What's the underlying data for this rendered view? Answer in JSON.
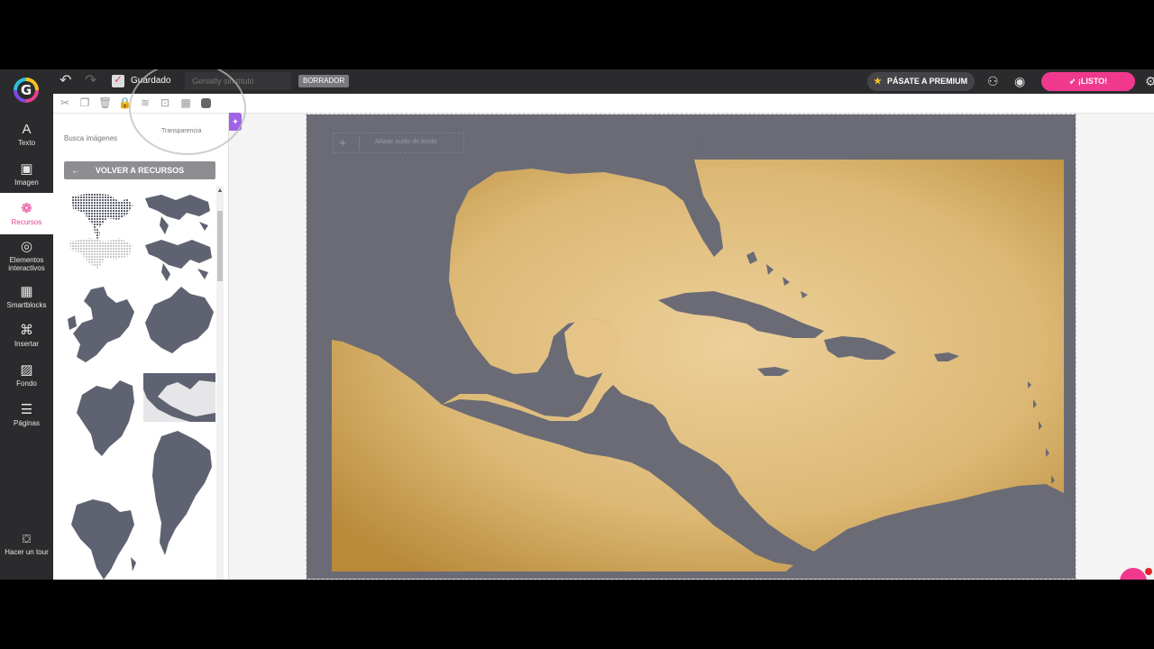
{
  "app": {
    "logo_letter": "G",
    "saved_label": "Guardado",
    "title_placeholder": "Genially sin título",
    "draft_badge": "BORRADOR",
    "premium_label": "PÁSATE A PREMIUM",
    "ready_label": "¡LISTO!"
  },
  "toolbar": {
    "tooltip": "Transparencia",
    "icons": [
      "cut-icon",
      "duplicate-icon",
      "delete-icon",
      "lock-icon",
      "layers-icon",
      "crop-icon",
      "transparency-icon",
      "color-icon"
    ]
  },
  "sidebar": {
    "items": [
      {
        "label": "Texto",
        "icon": "A"
      },
      {
        "label": "Imagen",
        "icon": "▣"
      },
      {
        "label": "Recursos",
        "icon": "❁"
      },
      {
        "label": "Elementos interactivos",
        "icon": "◎"
      },
      {
        "label": "Smartblocks",
        "icon": "▦"
      },
      {
        "label": "Insertar",
        "icon": "⌘"
      },
      {
        "label": "Fondo",
        "icon": "▨"
      },
      {
        "label": "Páginas",
        "icon": "☰"
      }
    ],
    "active_index": 2,
    "tour_label": "Hacer un tour"
  },
  "panel": {
    "search_placeholder": "Busca imágenes",
    "back_label": "VOLVER A RECURSOS",
    "thumbnails": [
      "world-map-dots",
      "world-map-dark",
      "world-map-dotted-gray",
      "world-map-dark-2",
      "europe-map",
      "asia-map",
      "north-america-map",
      "central-america-map",
      "south-america-map",
      "africa-map"
    ]
  },
  "canvas": {
    "audio_label": "Añade audio de fondo",
    "map_water_color": "#6b6b76",
    "map_land_color": "#e6c488",
    "accent_color": "#f0398e"
  }
}
